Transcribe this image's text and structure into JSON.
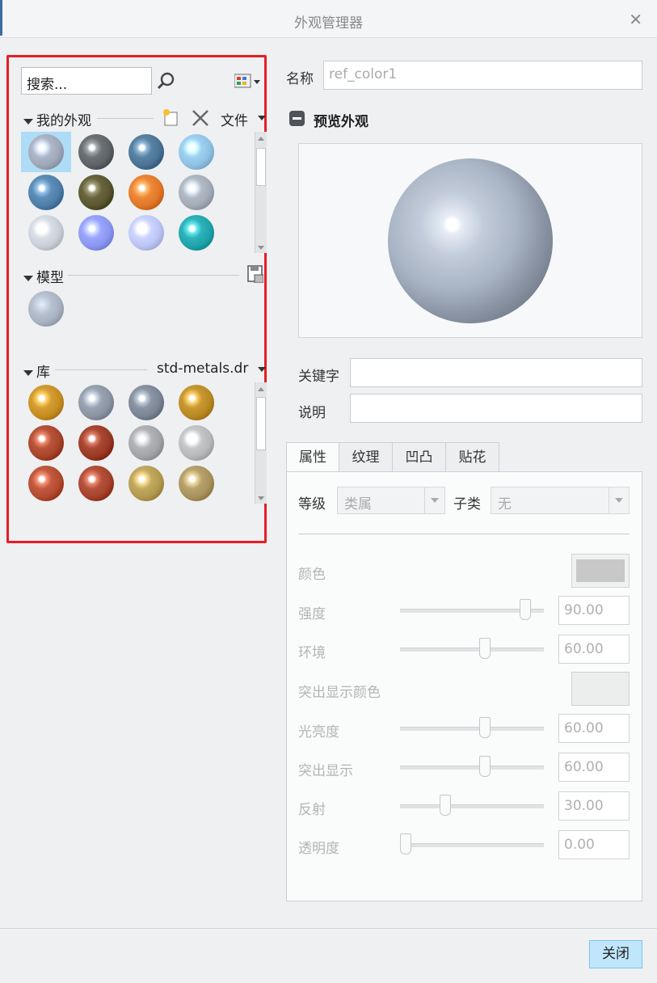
{
  "window": {
    "title": "外观管理器"
  },
  "left": {
    "search_placeholder": "搜索...",
    "my_appearances": {
      "label": "我的外观",
      "file_label": "文件"
    },
    "model": {
      "label": "模型"
    },
    "library": {
      "label": "库",
      "file": "std-metals.dr"
    }
  },
  "right": {
    "name_label": "名称",
    "name_value": "ref_color1",
    "preview_label": "预览外观",
    "keyword_label": "关键字",
    "description_label": "说明",
    "tabs": [
      "属性",
      "纹理",
      "凹凸",
      "贴花"
    ],
    "grade_label": "等级",
    "grade_value": "类属",
    "subclass_label": "子类",
    "subclass_value": "无",
    "props": {
      "color_label": "颜色",
      "color": "#c8c8c8",
      "intensity_label": "强度",
      "intensity_value": "90.00",
      "ambient_label": "环境",
      "ambient_value": "60.00",
      "highlight_color_label": "突出显示颜色",
      "highlight_color": "#eceeee",
      "shininess_label": "光亮度",
      "shininess_value": "60.00",
      "highlight_label": "突出显示",
      "highlight_value": "60.00",
      "reflection_label": "反射",
      "reflection_value": "30.00",
      "transparency_label": "透明度",
      "transparency_value": "0.00"
    },
    "close_label": "关闭"
  },
  "swatches": {
    "my": [
      "#9ea8b8",
      "#5d6366",
      "#4a7394",
      "#8fc1e3",
      "#4f7fa8",
      "#5a5630",
      "#e0782a",
      "#a3acb6",
      "#c9cfd6",
      "#8a96f0",
      "#bcc4f3",
      "#1fa4ab"
    ],
    "model": [
      "#a8b2c0"
    ],
    "lib": [
      "#c68e22",
      "#8b94a3",
      "#7c8593",
      "#b98a24",
      "#a8452b",
      "#9a3a24",
      "#a2a4a8",
      "#b7b8ba",
      "#b24b30",
      "#a5432c",
      "#b49a50",
      "#a8935c"
    ]
  }
}
